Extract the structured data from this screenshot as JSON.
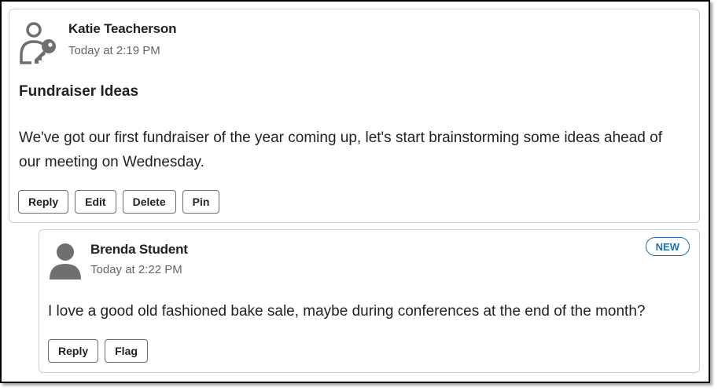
{
  "colors": {
    "accent": "#1f6fb2",
    "icon_gray": "#6f6f6f",
    "border": "#cfcfcf"
  },
  "parent_post": {
    "author": "Katie Teacherson",
    "timestamp": "Today at 2:19 PM",
    "avatar_icon": "person-key-icon",
    "title": "Fundraiser Ideas",
    "body": "We've got our first fundraiser of the year coming up, let's start brainstorming some ideas ahead of our meeting on Wednesday.",
    "actions": {
      "reply": "Reply",
      "edit": "Edit",
      "delete": "Delete",
      "pin": "Pin"
    }
  },
  "reply_post": {
    "author": "Brenda Student",
    "timestamp": "Today at 2:22 PM",
    "avatar_icon": "person-icon",
    "badge": "NEW",
    "body": "I love a good old fashioned bake sale, maybe during conferences at the end of the month?",
    "actions": {
      "reply": "Reply",
      "flag": "Flag"
    }
  }
}
